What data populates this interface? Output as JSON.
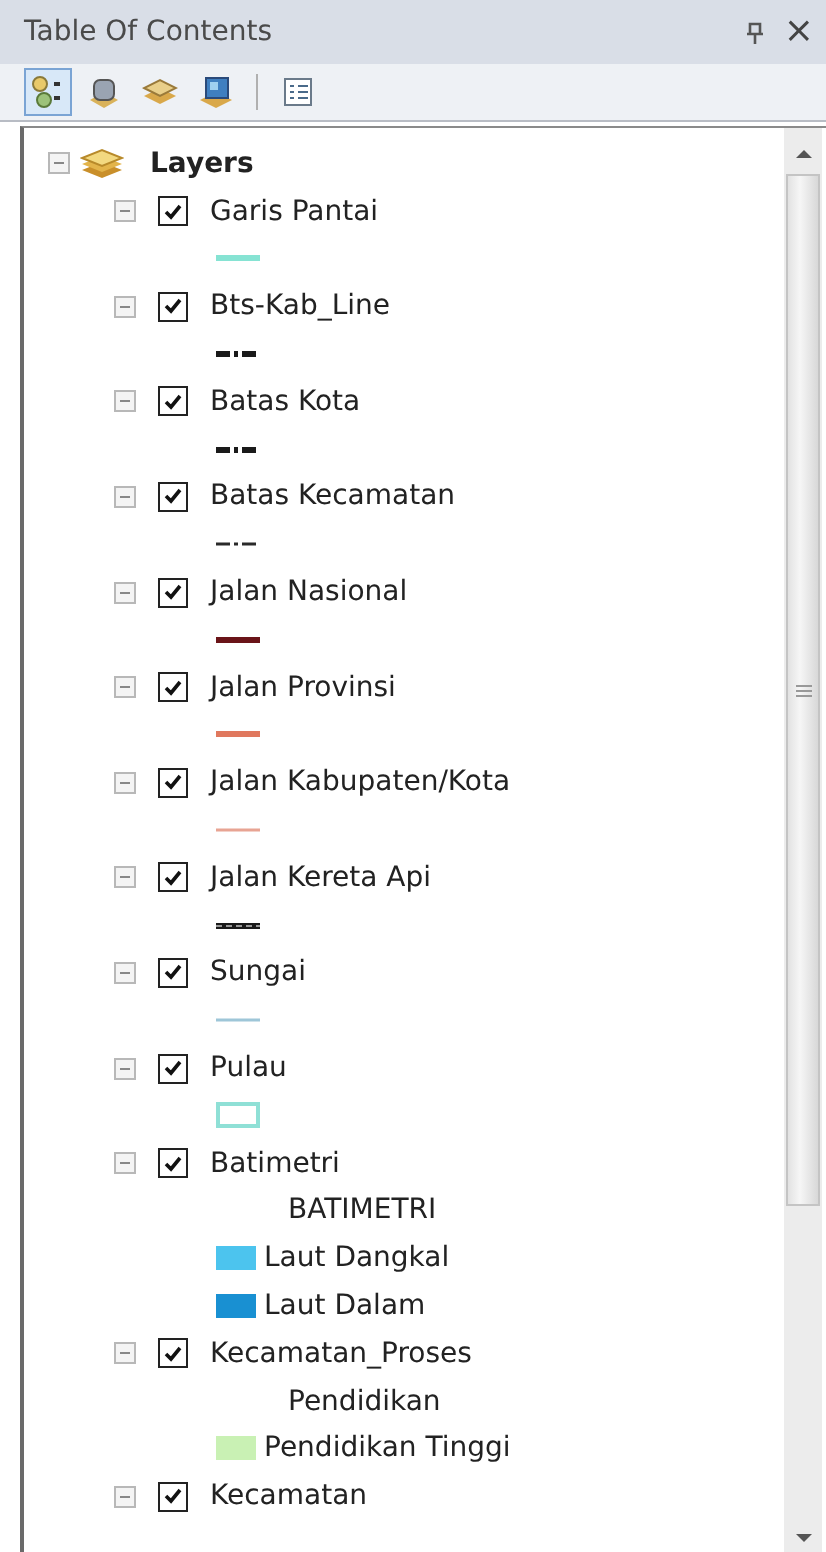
{
  "window": {
    "title": "Table Of Contents",
    "close": "×"
  },
  "toolbar": [
    {
      "kind": "list-by-drawing",
      "selected": true
    },
    {
      "kind": "list-by-source",
      "selected": false
    },
    {
      "kind": "list-by-visibility",
      "selected": false
    },
    {
      "kind": "list-by-selection",
      "selected": false
    },
    {
      "kind": "options",
      "selected": false
    }
  ],
  "root": {
    "label": "Layers",
    "expanded": true
  },
  "layers": [
    {
      "name": "Garis Pantai",
      "checked": true,
      "expanded": true,
      "symbol": {
        "kind": "line",
        "color": "#86e3d3",
        "dashed": false,
        "thick": true
      }
    },
    {
      "name": "Bts-Kab_Line",
      "checked": true,
      "expanded": true,
      "symbol": {
        "kind": "line",
        "color": "#1a1a1a",
        "dashed": true,
        "thick": true
      }
    },
    {
      "name": "Batas Kota",
      "checked": true,
      "expanded": true,
      "symbol": {
        "kind": "line",
        "color": "#1a1a1a",
        "dashed": true,
        "thick": true
      }
    },
    {
      "name": "Batas Kecamatan",
      "checked": true,
      "expanded": true,
      "symbol": {
        "kind": "line",
        "color": "#2a2a2a",
        "dashed": true,
        "thick": false
      }
    },
    {
      "name": "Jalan Nasional",
      "checked": true,
      "expanded": true,
      "symbol": {
        "kind": "line",
        "color": "#6a1418",
        "dashed": false,
        "thick": true
      }
    },
    {
      "name": "Jalan Provinsi",
      "checked": true,
      "expanded": true,
      "symbol": {
        "kind": "line",
        "color": "#e0785e",
        "dashed": false,
        "thick": true
      }
    },
    {
      "name": "Jalan Kabupaten/Kota",
      "checked": true,
      "expanded": true,
      "symbol": {
        "kind": "line",
        "color": "#e8a493",
        "dashed": false,
        "thick": false
      }
    },
    {
      "name": "Jalan Kereta Api",
      "checked": true,
      "expanded": true,
      "symbol": {
        "kind": "railway",
        "color": "#1a1a1a"
      }
    },
    {
      "name": "Sungai",
      "checked": true,
      "expanded": true,
      "symbol": {
        "kind": "line",
        "color": "#9ec6d8",
        "dashed": false,
        "thick": false
      }
    },
    {
      "name": "Pulau",
      "checked": true,
      "expanded": true,
      "symbol": {
        "kind": "outline",
        "color": "#8fe0d6"
      }
    },
    {
      "name": "Batimetri",
      "checked": true,
      "expanded": true,
      "symbol": {
        "kind": "classes",
        "heading": "BATIMETRI",
        "classes": [
          {
            "label": "Laut Dangkal",
            "color": "#4cc4ee"
          },
          {
            "label": "Laut Dalam",
            "color": "#1990d2"
          }
        ]
      }
    },
    {
      "name": "Kecamatan_Proses",
      "checked": true,
      "expanded": true,
      "symbol": {
        "kind": "classes",
        "heading": "Pendidikan",
        "classes": [
          {
            "label": "Pendidikan Tinggi",
            "color": "#c9f1b4"
          }
        ]
      }
    },
    {
      "name": "Kecamatan",
      "checked": true,
      "expanded": true
    }
  ]
}
